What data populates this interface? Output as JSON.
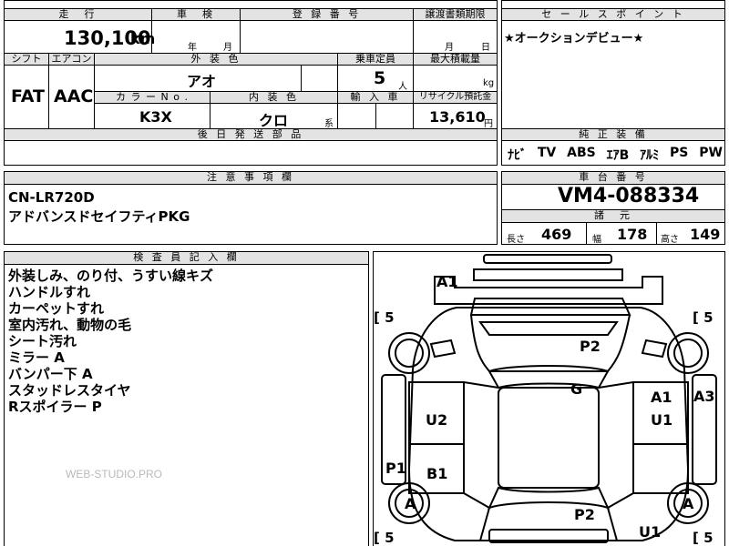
{
  "top": {
    "mileage_header": "走　行",
    "mileage_value": "130,100",
    "mileage_unit": "km",
    "shaken_header": "車　検",
    "shaken_year": "年",
    "shaken_month": "月",
    "registration_header": "登 録 番 号",
    "transfer_header": "譲渡書類期限",
    "transfer_month": "月",
    "transfer_day": "日",
    "shift_header": "シフト",
    "shift_value": "FAT",
    "aircon_header": "エアコン",
    "aircon_value": "AAC",
    "exterior_color_header": "外 装 色",
    "exterior_color_value": "アオ",
    "capacity_header": "乗車定員",
    "capacity_value": "5",
    "capacity_unit": "人",
    "max_load_header": "最大積載量",
    "max_load_unit": "kg",
    "color_no_header": "カ ラ ー N o .",
    "color_no_value": "K3X",
    "interior_color_header": "内 装 色",
    "interior_color_value": "クロ",
    "interior_color_suffix": "系",
    "import_header": "輸 入 車",
    "recycle_header": "リサイクル預託金",
    "recycle_value": "13,610",
    "recycle_unit": "円",
    "followup_header": "後 日 発 送 部 品"
  },
  "sales": {
    "header": "セ ー ル ス ポ イ ン ト",
    "text": "★オークションデビュー★"
  },
  "equipment": {
    "header": "純 正 装 備",
    "items": [
      "ﾅﾋﾞ",
      "TV",
      "ABS",
      "ｴｱB",
      "ｱﾙﾐ",
      "PS",
      "PW"
    ]
  },
  "notes": {
    "header": "注 意 事 項 欄",
    "line1": "CN-LR720D",
    "line2": "アドバンスドセイフティPKG"
  },
  "chassis": {
    "header": "車 台 番 号",
    "value": "VM4-088334"
  },
  "dims": {
    "header": "諸　元",
    "length_label": "長さ",
    "length_value": "469",
    "width_label": "幅",
    "width_value": "178",
    "height_label": "高さ",
    "height_value": "149"
  },
  "inspector": {
    "header": "検 査 員 記 入 欄",
    "lines": [
      "外装しみ、のり付、うすい線キズ",
      "ハンドルすれ",
      "カーペットすれ",
      "室内汚れ、動物の毛",
      "シート汚れ",
      "ミラー A",
      "バンパー下 A",
      "スタッドレスタイヤ",
      "Rスポイラー P"
    ],
    "watermark": "WEB-STUDIO.PRO"
  },
  "diagram": {
    "marks": {
      "front_bumper": "A1",
      "hood": "P2",
      "roof": "G",
      "right_front_door": "A1",
      "right_front_fender": "A3",
      "right_rear_door": "U1",
      "left_front_door": "U2",
      "left_rear_fender": "P1",
      "left_rear_door": "B1",
      "trunk": "P2",
      "rear_bumper": "U1",
      "left_rear_wheel": "A",
      "right_rear_wheel": "A"
    },
    "tires": {
      "front_left": "5",
      "front_right": "5",
      "rear_left": "5",
      "rear_right": "5"
    },
    "bracket_open": "[",
    "bracket_close": "]"
  }
}
